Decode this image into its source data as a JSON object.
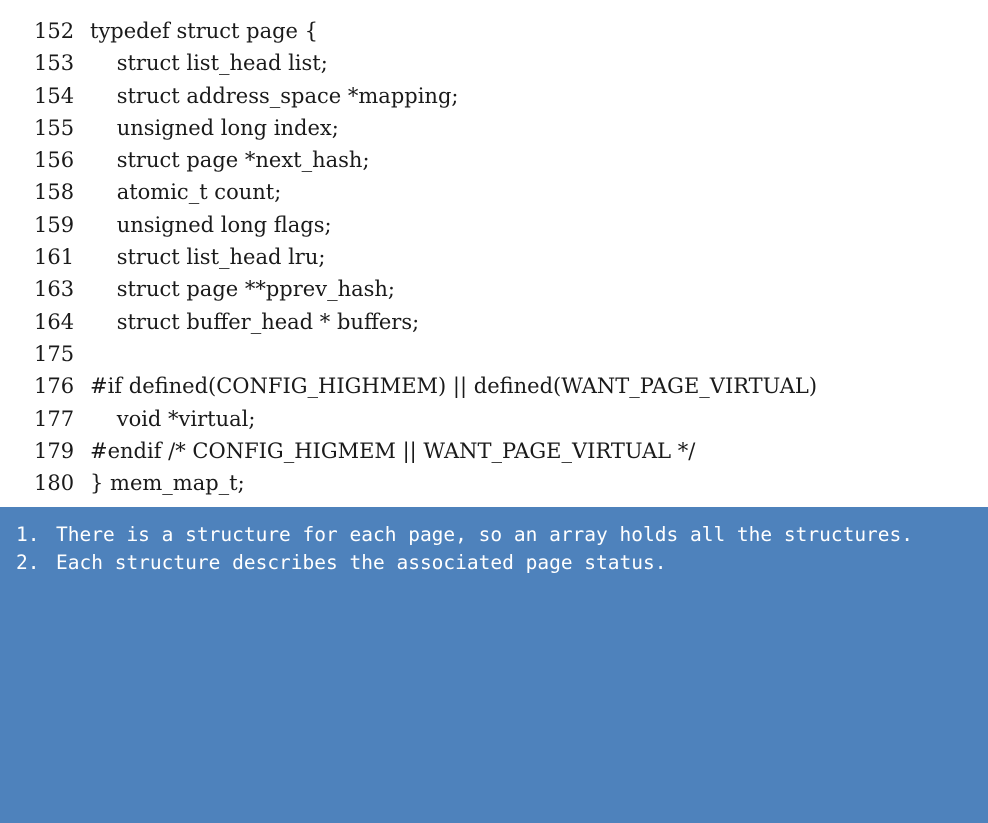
{
  "code": {
    "lines": [
      {
        "no": "152",
        "text": "typedef struct page {"
      },
      {
        "no": "153",
        "text": "    struct list_head list;"
      },
      {
        "no": "154",
        "text": "    struct address_space *mapping;"
      },
      {
        "no": "155",
        "text": "    unsigned long index;"
      },
      {
        "no": "156",
        "text": "    struct page *next_hash;"
      },
      {
        "no": "158",
        "text": "    atomic_t count;"
      },
      {
        "no": "159",
        "text": "    unsigned long flags;"
      },
      {
        "no": "161",
        "text": "    struct list_head lru;"
      },
      {
        "no": "163",
        "text": "    struct page **pprev_hash;"
      },
      {
        "no": "164",
        "text": "    struct buffer_head * buffers;"
      },
      {
        "no": "175",
        "text": ""
      },
      {
        "no": "176",
        "text": "#if defined(CONFIG_HIGHMEM) || defined(WANT_PAGE_VIRTUAL)"
      },
      {
        "no": "177",
        "text": "    void *virtual;"
      },
      {
        "no": "179",
        "text": "#endif /* CONFIG_HIGMEM || WANT_PAGE_VIRTUAL */"
      },
      {
        "no": "180",
        "text": "} mem_map_t;"
      }
    ]
  },
  "notes": {
    "background_color": "#4e82bc",
    "items": [
      {
        "num": "1.",
        "text": "There is a structure for each page, so an array holds all the structures."
      },
      {
        "num": "2.",
        "text": "Each structure describes the associated page status."
      }
    ]
  }
}
